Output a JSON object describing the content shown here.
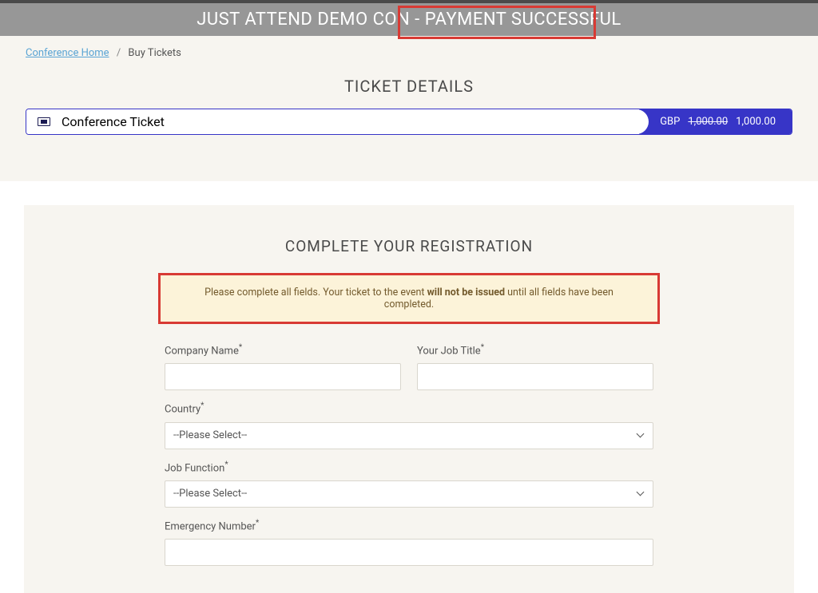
{
  "header": {
    "title": "JUST ATTEND DEMO CON - PAYMENT SUCCESSFUL"
  },
  "breadcrumb": {
    "home_label": "Conference Home",
    "current_label": "Buy Tickets"
  },
  "ticket_section": {
    "title": "TICKET DETAILS",
    "ticket_name": "Conference Ticket",
    "currency": "GBP",
    "original_price": "1,000.00",
    "price": "1,000.00"
  },
  "registration": {
    "title": "COMPLETE YOUR REGISTRATION",
    "notice_pre": "Please complete all fields. Your ticket to the event ",
    "notice_bold": "will not be issued",
    "notice_post": " until all fields have been completed.",
    "fields": {
      "company_label": "Company Name",
      "job_title_label": "Your Job Title",
      "country_label": "Country",
      "country_placeholder": "--Please Select--",
      "job_function_label": "Job Function",
      "job_function_placeholder": "--Please Select--",
      "emergency_label": "Emergency Number"
    },
    "required_marker": "*"
  }
}
